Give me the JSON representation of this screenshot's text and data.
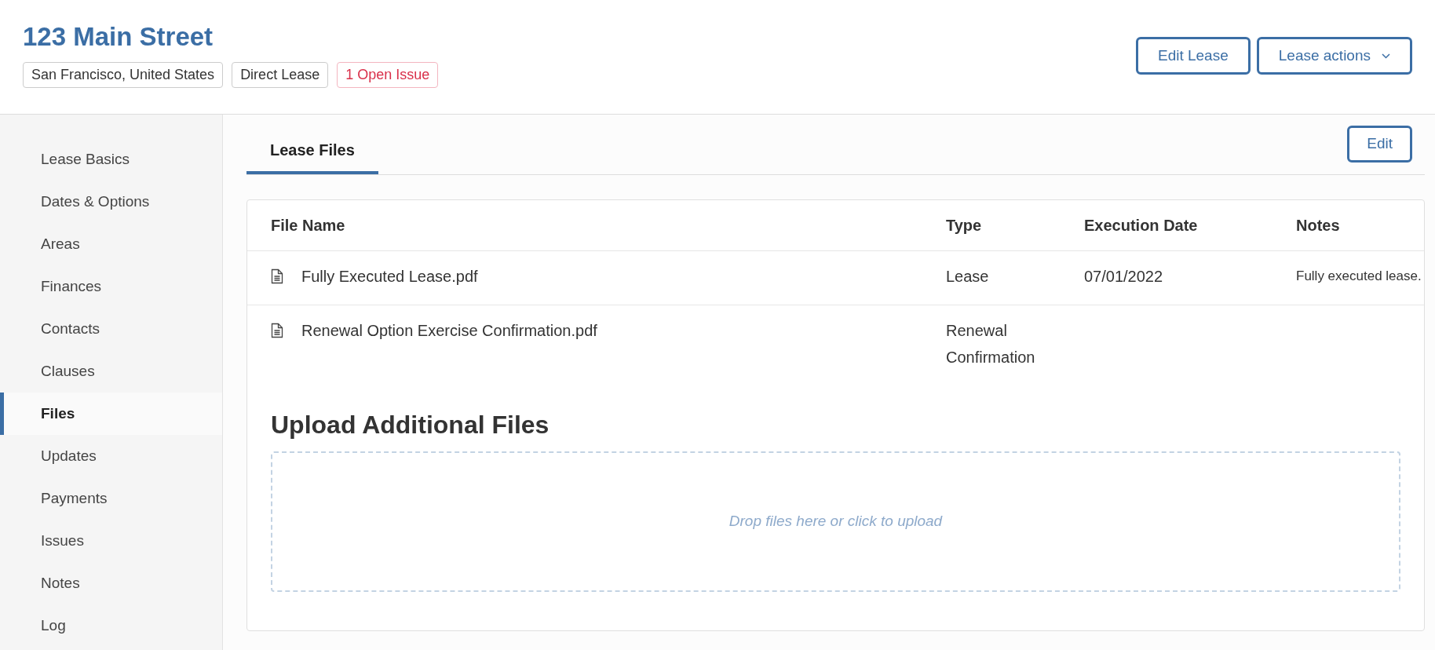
{
  "header": {
    "title": "123 Main Street",
    "tags": [
      {
        "label": "San Francisco, United States",
        "kind": "neutral"
      },
      {
        "label": "Direct Lease",
        "kind": "neutral"
      },
      {
        "label": "1 Open Issue",
        "kind": "alert"
      }
    ],
    "buttons": [
      {
        "label": "Edit Lease",
        "kind": "plain"
      },
      {
        "label": "Lease actions",
        "kind": "dropdown"
      }
    ]
  },
  "sidebar": {
    "items": [
      {
        "label": "Lease Basics",
        "selected": false
      },
      {
        "label": "Dates & Options",
        "selected": false
      },
      {
        "label": "Areas",
        "selected": false
      },
      {
        "label": "Finances",
        "selected": false
      },
      {
        "label": "Contacts",
        "selected": false
      },
      {
        "label": "Clauses",
        "selected": false
      },
      {
        "label": "Files",
        "selected": true
      },
      {
        "label": "Updates",
        "selected": false
      },
      {
        "label": "Payments",
        "selected": false
      },
      {
        "label": "Issues",
        "selected": false
      },
      {
        "label": "Notes",
        "selected": false
      },
      {
        "label": "Log",
        "selected": false
      }
    ]
  },
  "tabs": [
    {
      "label": "Lease Files",
      "selected": true
    }
  ],
  "edit_button": "Edit",
  "table": {
    "columns": [
      "File Name",
      "Type",
      "Execution Date",
      "Notes"
    ],
    "rows": [
      {
        "file_name": "Fully Executed Lease.pdf",
        "type": "Lease",
        "execution_date": "07/01/2022",
        "notes": "Fully executed lease."
      },
      {
        "file_name": "Renewal Option Exercise Confirmation.pdf",
        "type": "Renewal Confirmation"
      }
    ]
  },
  "upload": {
    "heading": "Upload Additional Files",
    "dropzone_text": "Drop files here or click to upload"
  }
}
